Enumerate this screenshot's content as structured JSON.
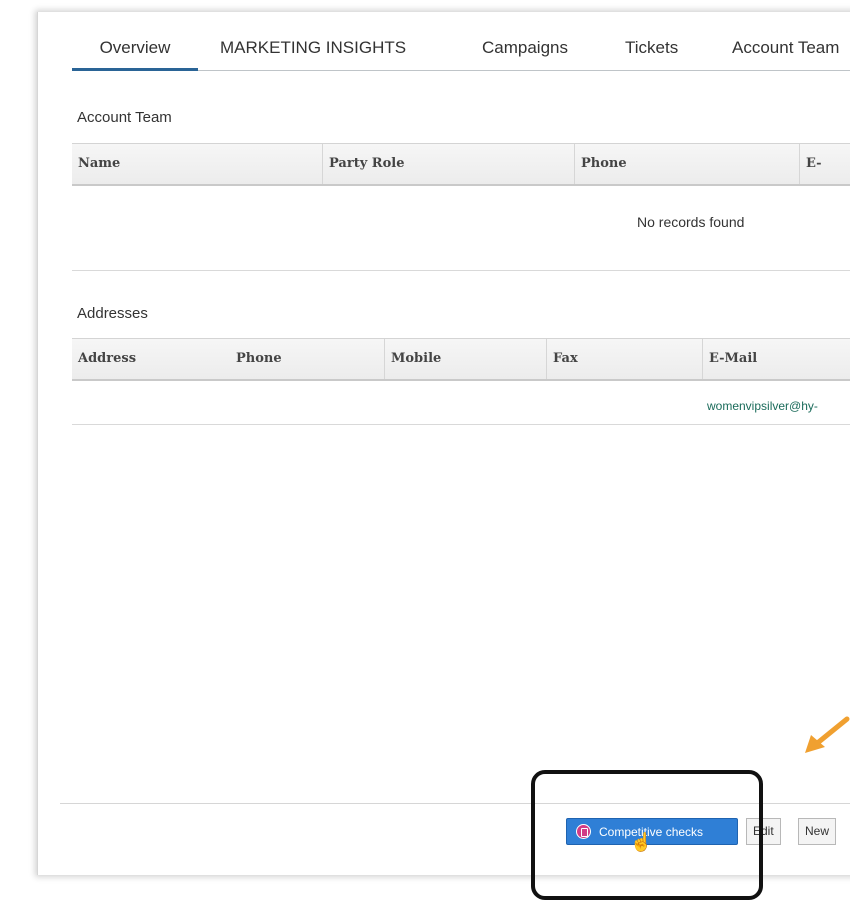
{
  "tabs": [
    {
      "label": "Overview",
      "active": true
    },
    {
      "label": "MARKETING INSIGHTS",
      "active": false
    },
    {
      "label": "Campaigns",
      "active": false
    },
    {
      "label": "Tickets",
      "active": false
    },
    {
      "label": "Account Team",
      "active": false
    }
  ],
  "account_team": {
    "title": "Account Team",
    "columns": [
      "Name",
      "Party Role",
      "Phone",
      "E-"
    ],
    "empty_message": "No records found"
  },
  "addresses": {
    "title": "Addresses",
    "columns": [
      "Address",
      "Phone",
      "Mobile",
      "Fax",
      "E-Mail"
    ],
    "rows": [
      {
        "email": "womenvipsilver@hy-"
      }
    ]
  },
  "footer": {
    "competitive_checks_label": "Competitive checks",
    "edit_label": "Edit",
    "new_label": "New"
  },
  "colors": {
    "active_tab_underline": "#2a6496",
    "primary_button": "#2f7fd6",
    "annotation_arrow": "#f0a030",
    "link_text": "#1a6b5a"
  }
}
